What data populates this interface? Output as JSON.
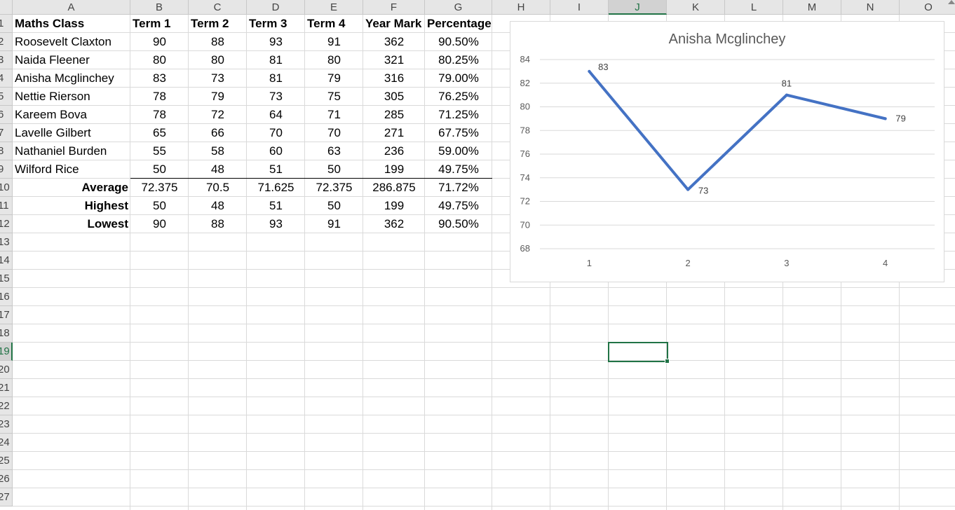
{
  "columns": [
    "A",
    "B",
    "C",
    "D",
    "E",
    "F",
    "G",
    "H",
    "I",
    "J",
    "K",
    "L",
    "M",
    "N",
    "O"
  ],
  "selected_column": "J",
  "rows": [
    "1",
    "2",
    "3",
    "4",
    "5",
    "6",
    "7",
    "8",
    "9",
    "10",
    "11",
    "12",
    "13",
    "14",
    "15",
    "16",
    "17",
    "18",
    "19",
    "20",
    "21",
    "22",
    "23",
    "24",
    "25",
    "26",
    "27"
  ],
  "selected_row": "19",
  "table": {
    "headers": [
      "Maths Class",
      "Term 1",
      "Term 2",
      "Term 3",
      "Term 4",
      "Year Mark",
      "Percentage"
    ],
    "students": [
      [
        "Roosevelt Claxton",
        "90",
        "88",
        "93",
        "91",
        "362",
        "90.50%"
      ],
      [
        "Naida Fleener",
        "80",
        "80",
        "81",
        "80",
        "321",
        "80.25%"
      ],
      [
        "Anisha Mcglinchey",
        "83",
        "73",
        "81",
        "79",
        "316",
        "79.00%"
      ],
      [
        "Nettie Rierson",
        "78",
        "79",
        "73",
        "75",
        "305",
        "76.25%"
      ],
      [
        "Kareem Bova",
        "78",
        "72",
        "64",
        "71",
        "285",
        "71.25%"
      ],
      [
        "Lavelle Gilbert",
        "65",
        "66",
        "70",
        "70",
        "271",
        "67.75%"
      ],
      [
        "Nathaniel Burden",
        "55",
        "58",
        "60",
        "63",
        "236",
        "59.00%"
      ],
      [
        "Wilford Rice",
        "50",
        "48",
        "51",
        "50",
        "199",
        "49.75%"
      ]
    ],
    "summary": [
      [
        "Average",
        "72.375",
        "70.5",
        "71.625",
        "72.375",
        "286.875",
        "71.72%"
      ],
      [
        "Highest",
        "50",
        "48",
        "51",
        "50",
        "199",
        "49.75%"
      ],
      [
        "Lowest",
        "90",
        "88",
        "93",
        "91",
        "362",
        "90.50%"
      ]
    ]
  },
  "chart_data": {
    "type": "line",
    "title": "Anisha Mcglinchey",
    "x": [
      "1",
      "2",
      "3",
      "4"
    ],
    "series": [
      {
        "values": [
          83,
          73,
          81,
          79
        ],
        "color": "#4472c4"
      }
    ],
    "ylim": [
      68,
      84
    ],
    "yticks": [
      "68",
      "70",
      "72",
      "74",
      "76",
      "78",
      "80",
      "82",
      "84"
    ],
    "grid": true,
    "data_labels": true
  }
}
